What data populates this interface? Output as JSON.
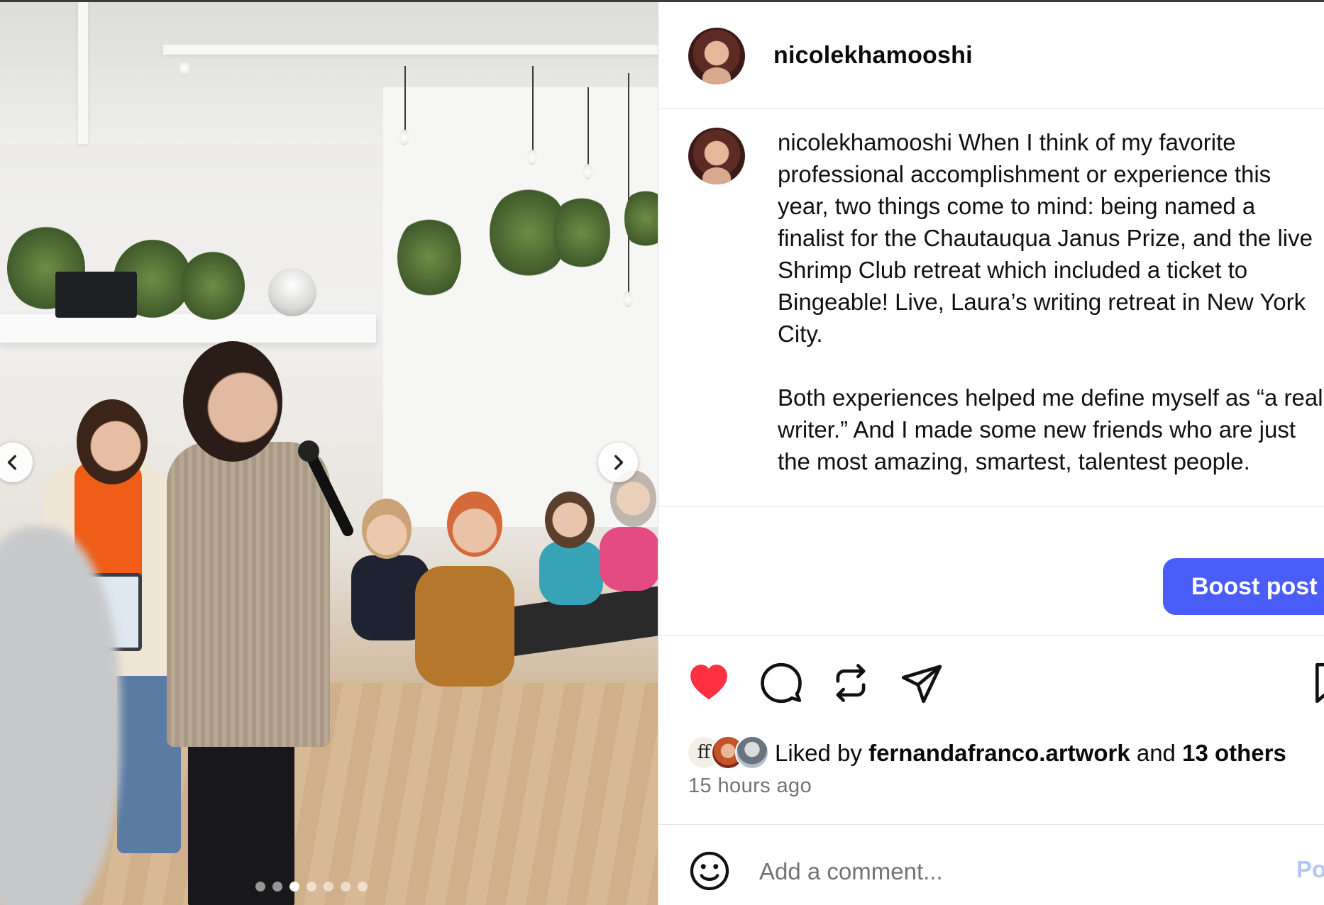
{
  "post": {
    "username": "nicolekhamooshi",
    "caption": {
      "username": "nicolekhamooshi",
      "paragraph1": " When I think of my favorite professional accomplishment or experience this year, two things come to mind: being named a finalist for the Chautauqua Janus Prize, and the live Shrimp Club retreat which included a ticket to Bingeable! Live, Laura’s writing retreat in New York City.",
      "paragraph2": "Both experiences helped me define myself as “a real writer.” And I made some new friends who are just the most amazing, smartest, talentest people."
    },
    "boost_label": "Boost post",
    "likes": {
      "prefix": "Liked by ",
      "liker": "fernandafranco.artwork",
      "and": " and ",
      "others": "13 others",
      "liker_initials": "ff"
    },
    "timestamp": "15 hours ago",
    "comment": {
      "placeholder": "Add a comment...",
      "post_label": "Post"
    }
  },
  "carousel": {
    "slide_count": 7,
    "active_index": 2
  },
  "icons": {
    "like": "heart-icon",
    "comment": "speech-bubble-icon",
    "repost": "repost-icon",
    "share": "paper-plane-icon",
    "save": "bookmark-icon",
    "emoji": "smiley-icon",
    "prev": "chevron-left-icon",
    "next": "chevron-right-icon"
  },
  "colors": {
    "like_red": "#ff3040",
    "boost_blue": "#4a5df9",
    "muted_text": "#737373",
    "post_link_disabled": "#b3c7f7"
  }
}
